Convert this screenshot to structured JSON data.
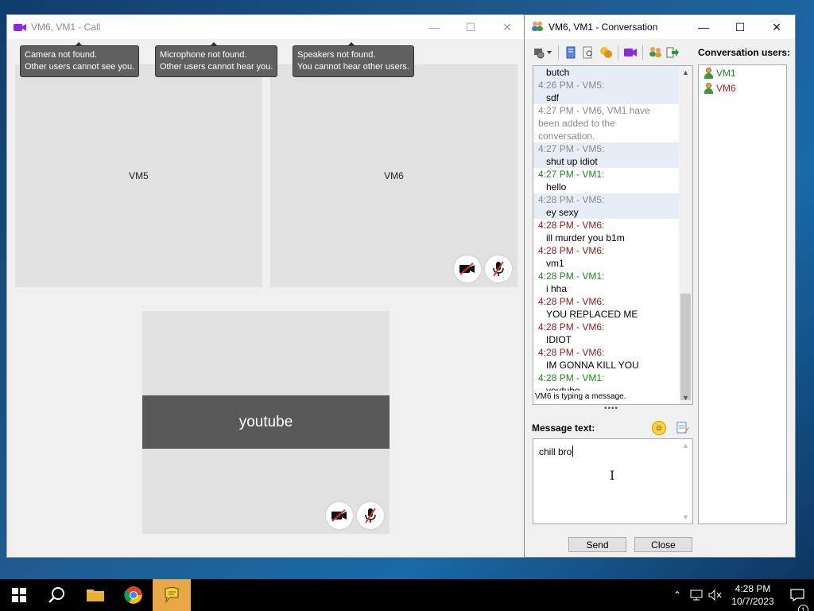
{
  "call_window": {
    "title": "VM6, VM1 - Call",
    "tooltips": [
      {
        "line1": "Camera not found.",
        "line2": "Other users cannot see you."
      },
      {
        "line1": "Microphone not found.",
        "line2": "Other users cannot hear you."
      },
      {
        "line1": "Speakers not found.",
        "line2": "You cannot hear other users."
      }
    ],
    "tiles": {
      "vm5": "VM5",
      "vm6": "VM6",
      "self_caption": "youtube"
    }
  },
  "conversation_window": {
    "title": "VM6, VM1 - Conversation",
    "users_label": "Conversation users:",
    "users": [
      {
        "name": "VM1",
        "color": "#1a8a1a"
      },
      {
        "name": "VM6",
        "color": "#aa1a1a"
      }
    ],
    "messages": [
      {
        "header": "",
        "text": "butch",
        "style": "hl"
      },
      {
        "header": "4:26 PM - VM5:",
        "text": "sdf",
        "style": "hl",
        "color": "grey"
      },
      {
        "header": "4:27 PM - VM6, VM1 have",
        "text": "",
        "style": "",
        "color": "grey"
      },
      {
        "header": "been added to the",
        "text": "",
        "style": "",
        "color": "grey"
      },
      {
        "header": "conversation.",
        "text": "",
        "style": "",
        "color": "grey"
      },
      {
        "header": "4:27 PM - VM5:",
        "text": "shut up idiot",
        "style": "hl",
        "color": "grey"
      },
      {
        "header": "4:27 PM - VM1:",
        "text": "hello",
        "style": "",
        "color": "green"
      },
      {
        "header": "4:28 PM - VM5:",
        "text": "ey sexy",
        "style": "hl",
        "color": "grey"
      },
      {
        "header": "4:28 PM - VM6:",
        "text": "ill murder you b1m",
        "style": "",
        "color": "red"
      },
      {
        "header": "4:28 PM - VM6:",
        "text": "vm1",
        "style": "",
        "color": "red"
      },
      {
        "header": "4:28 PM - VM1:",
        "text": "i hha",
        "style": "",
        "color": "green"
      },
      {
        "header": "4:28 PM - VM6:",
        "text": "YOU REPLACED ME",
        "style": "",
        "color": "red"
      },
      {
        "header": "4:28 PM - VM6:",
        "text": "IDIOT",
        "style": "",
        "color": "red"
      },
      {
        "header": "4:28 PM - VM6:",
        "text": "IM GONNA KILL YOU",
        "style": "",
        "color": "red"
      },
      {
        "header": "4:28 PM - VM1:",
        "text": "youtube",
        "style": "",
        "color": "green"
      }
    ],
    "typing_status": "VM6 is typing a message.",
    "message_label": "Message text:",
    "input_value": "chill bro",
    "send_label": "Send",
    "close_label": "Close"
  },
  "taskbar": {
    "time": "4:28 PM",
    "date": "10/7/2023",
    "notification_count": "1"
  }
}
